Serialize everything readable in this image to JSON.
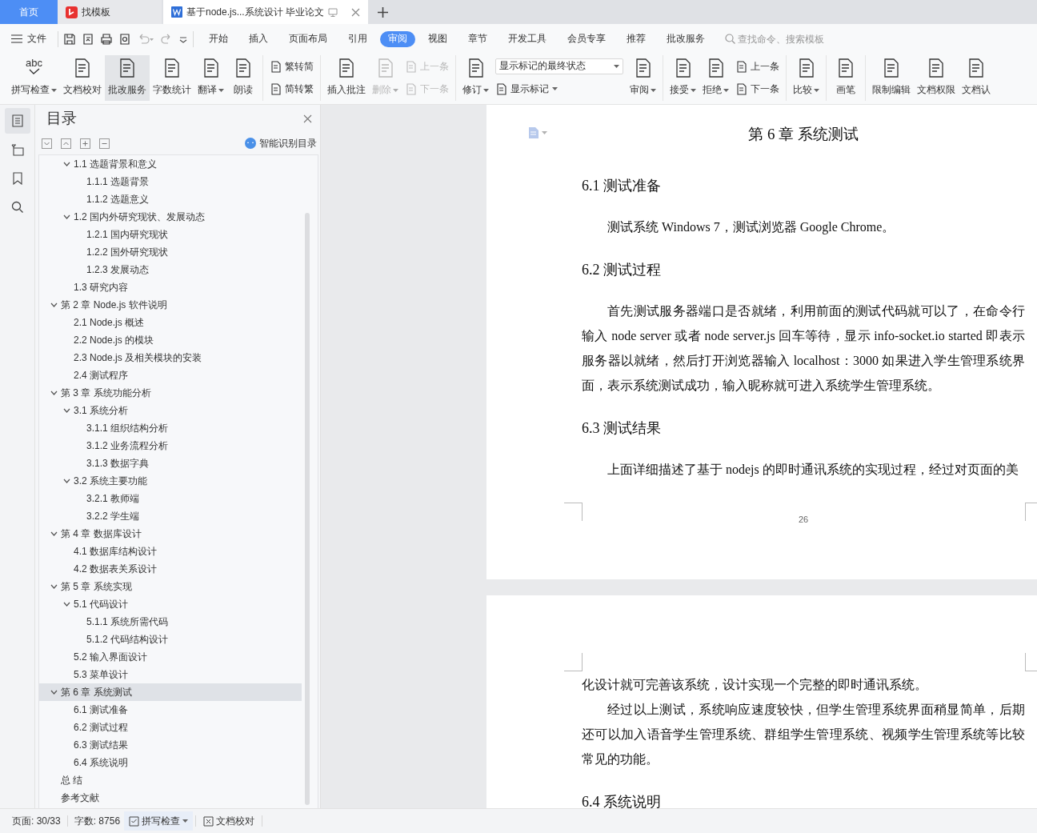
{
  "tabs": [
    {
      "kind": "home",
      "label": "首页",
      "selected": false
    },
    {
      "kind": "app",
      "label": "找模板",
      "selected": false
    },
    {
      "kind": "document",
      "label": "基于node.js...系统设计 毕业论文",
      "selected": true
    }
  ],
  "menu": {
    "file": "文件",
    "tabs": [
      {
        "label": "开始",
        "selected": false
      },
      {
        "label": "插入",
        "selected": false
      },
      {
        "label": "页面布局",
        "selected": false
      },
      {
        "label": "引用",
        "selected": false
      },
      {
        "label": "审阅",
        "selected": true
      },
      {
        "label": "视图",
        "selected": false
      },
      {
        "label": "章节",
        "selected": false
      },
      {
        "label": "开发工具",
        "selected": false
      },
      {
        "label": "会员专享",
        "selected": false
      },
      {
        "label": "推荐",
        "selected": false
      },
      {
        "label": "批改服务",
        "selected": false
      }
    ],
    "search": {
      "placeholder": "查找命令、搜索模板"
    }
  },
  "ribbon": [
    {
      "items": [
        {
          "kind": "large",
          "label": "拼写检查",
          "icon_text": "abc",
          "dropdown": true,
          "active": false,
          "disabled": false
        },
        {
          "kind": "large",
          "label": "文档校对",
          "dropdown": false,
          "active": false,
          "disabled": false
        },
        {
          "kind": "large",
          "label": "批改服务",
          "dropdown": false,
          "active": true,
          "disabled": false
        },
        {
          "kind": "large",
          "label": "字数统计",
          "dropdown": false,
          "active": false,
          "disabled": false
        },
        {
          "kind": "large",
          "label": "翻译",
          "dropdown": true,
          "active": false,
          "disabled": false
        },
        {
          "kind": "large",
          "label": "朗读",
          "dropdown": false,
          "active": false,
          "disabled": false
        }
      ]
    },
    {
      "items": [
        {
          "kind": "stack",
          "items": [
            {
              "label": "繁转简",
              "dropdown": false,
              "disabled": false
            },
            {
              "label": "简转繁",
              "dropdown": false,
              "disabled": false
            }
          ]
        }
      ]
    },
    {
      "items": [
        {
          "kind": "large",
          "label": "插入批注",
          "dropdown": false,
          "active": false,
          "disabled": false
        },
        {
          "kind": "large",
          "label": "删除",
          "dropdown": true,
          "active": false,
          "disabled": true
        },
        {
          "kind": "stack",
          "items": [
            {
              "label": "上一条",
              "dropdown": false,
              "disabled": true
            },
            {
              "label": "下一条",
              "dropdown": false,
              "disabled": true
            }
          ]
        }
      ]
    },
    {
      "items": [
        {
          "kind": "large",
          "label": "修订",
          "dropdown": true,
          "active": false,
          "disabled": false
        },
        {
          "kind": "stack",
          "items": [
            {
              "kind": "select",
              "label": "显示标记的最终状态"
            },
            {
              "label": "显示标记",
              "dropdown": true,
              "disabled": false
            }
          ]
        },
        {
          "kind": "large",
          "label": "审阅",
          "dropdown": true,
          "active": false,
          "disabled": false
        }
      ]
    },
    {
      "items": [
        {
          "kind": "large",
          "label": "接受",
          "dropdown": true,
          "active": false,
          "disabled": false
        },
        {
          "kind": "large",
          "label": "拒绝",
          "dropdown": true,
          "active": false,
          "disabled": false
        },
        {
          "kind": "stack",
          "items": [
            {
              "label": "上一条",
              "dropdown": false,
              "disabled": false
            },
            {
              "label": "下一条",
              "dropdown": false,
              "disabled": false
            }
          ]
        }
      ]
    },
    {
      "items": [
        {
          "kind": "large",
          "label": "比较",
          "dropdown": true,
          "active": false,
          "disabled": false
        }
      ]
    },
    {
      "items": [
        {
          "kind": "large",
          "label": "画笔",
          "dropdown": false,
          "active": false,
          "disabled": false
        }
      ]
    },
    {
      "items": [
        {
          "kind": "large",
          "label": "限制编辑",
          "dropdown": false,
          "active": false,
          "disabled": false
        },
        {
          "kind": "large",
          "label": "文档权限",
          "dropdown": false,
          "active": false,
          "disabled": false
        },
        {
          "kind": "large",
          "label": "文档认",
          "dropdown": false,
          "active": false,
          "disabled": false
        }
      ]
    }
  ],
  "side_tools": [
    {
      "selected": true
    },
    {
      "selected": false
    },
    {
      "selected": false
    },
    {
      "selected": false
    }
  ],
  "toc": {
    "title": "目录",
    "smart_button": "智能识别目录",
    "items": [
      {
        "children": [
          {
            "label": "1.1 选题背景和意义",
            "selected": false,
            "expanded": true,
            "children": [
              {
                "label": "1.1.1 选题背景",
                "selected": false
              },
              {
                "label": "1.1.2 选题意义",
                "selected": false
              }
            ]
          },
          {
            "label": "1.2 国内外研究现状、发展动态",
            "selected": false,
            "expanded": true,
            "children": [
              {
                "label": "1.2.1 国内研究现状",
                "selected": false
              },
              {
                "label": "1.2.2 国外研究现状",
                "selected": false
              },
              {
                "label": "1.2.3 发展动态",
                "selected": false
              }
            ]
          },
          {
            "label": "1.3 研究内容",
            "selected": false
          }
        ]
      },
      {
        "label": "第 2 章  Node.js 软件说明",
        "selected": false,
        "expanded": true,
        "children": [
          {
            "label": "2.1 Node.js 概述",
            "selected": false
          },
          {
            "label": "2.2 Node.js 的模块",
            "selected": false
          },
          {
            "label": "2.3 Node.js 及相关模块的安装",
            "selected": false
          },
          {
            "label": "2.4  测试程序",
            "selected": false
          }
        ]
      },
      {
        "label": "第 3 章  系统功能分析",
        "selected": false,
        "expanded": true,
        "children": [
          {
            "label": "3.1 系统分析",
            "selected": false,
            "expanded": true,
            "children": [
              {
                "label": "3.1.1 组织结构分析",
                "selected": false
              },
              {
                "label": "3.1.2 业务流程分析",
                "selected": false
              },
              {
                "label": "3.1.3 数据字典",
                "selected": false
              }
            ]
          },
          {
            "label": "3.2 系统主要功能",
            "selected": false,
            "expanded": true,
            "children": [
              {
                "label": "3.2.1  教师端",
                "selected": false
              },
              {
                "label": "3.2.2  学生端",
                "selected": false
              }
            ]
          }
        ]
      },
      {
        "label": "第 4 章  数据库设计",
        "selected": false,
        "expanded": true,
        "children": [
          {
            "label": "4.1 数据库结构设计",
            "selected": false
          },
          {
            "label": "4.2 数据表关系设计",
            "selected": false
          }
        ]
      },
      {
        "label": "第 5 章  系统实现",
        "selected": false,
        "expanded": true,
        "children": [
          {
            "label": "5.1 代码设计",
            "selected": false,
            "expanded": true,
            "children": [
              {
                "label": "5.1.1 系统所需代码",
                "selected": false
              },
              {
                "label": "5.1.2 代码结构设计",
                "selected": false
              }
            ]
          },
          {
            "label": "5.2 输入界面设计",
            "selected": false
          },
          {
            "label": "5.3 菜单设计",
            "selected": false
          }
        ]
      },
      {
        "label": "第 6 章  系统测试",
        "selected": true,
        "expanded": true,
        "children": [
          {
            "label": "6.1 测试准备",
            "selected": false
          },
          {
            "label": "6.2 测试过程",
            "selected": false
          },
          {
            "label": "6.3 测试结果",
            "selected": false
          },
          {
            "label": "6.4 系统说明",
            "selected": false
          }
        ]
      },
      {
        "label": "总  结",
        "selected": false
      },
      {
        "label": "参考文献",
        "selected": false
      }
    ]
  },
  "document": {
    "pages": [
      {
        "number": "26",
        "blocks": [
          {
            "kind": "title",
            "text": "第 6 章  系统测试"
          },
          {
            "kind": "heading",
            "text": "6.1 测试准备"
          },
          {
            "kind": "paragraph",
            "text": "测试系统 Windows 7，测试浏览器 Google Chrome。"
          },
          {
            "kind": "heading",
            "text": "6.2 测试过程"
          },
          {
            "kind": "paragraph",
            "text": "首先测试服务器端口是否就绪，利用前面的测试代码就可以了，在命令行输入 node server 或者 node server.js 回车等待，显示  info-socket.io started 即表示服务器以就绪，然后打开浏览器输入 localhost：3000 如果进入学生管理系统界面，表示系统测试成功，输入昵称就可进入系统学生管理系统。"
          },
          {
            "kind": "heading",
            "text": "6.3 测试结果"
          },
          {
            "kind": "paragraph",
            "text": "上面详细描述了基于 nodejs 的即时通讯系统的实现过程，经过对页面的美"
          }
        ]
      },
      {
        "blocks": [
          {
            "kind": "continuation",
            "text": "化设计就可完善该系统，设计实现一个完整的即时通讯系统。"
          },
          {
            "kind": "paragraph",
            "text": "经过以上测试，系统响应速度较快，但学生管理系统界面稍显简单，后期还可以加入语音学生管理系统、群组学生管理系统、视频学生管理系统等比较常见的功能。"
          },
          {
            "kind": "heading",
            "text": "6.4 系统说明"
          }
        ]
      }
    ]
  },
  "status_bar": {
    "page": "页面: 30/33",
    "words": "字数: 8756",
    "spell": "拼写检查",
    "proof": "文档校对"
  }
}
